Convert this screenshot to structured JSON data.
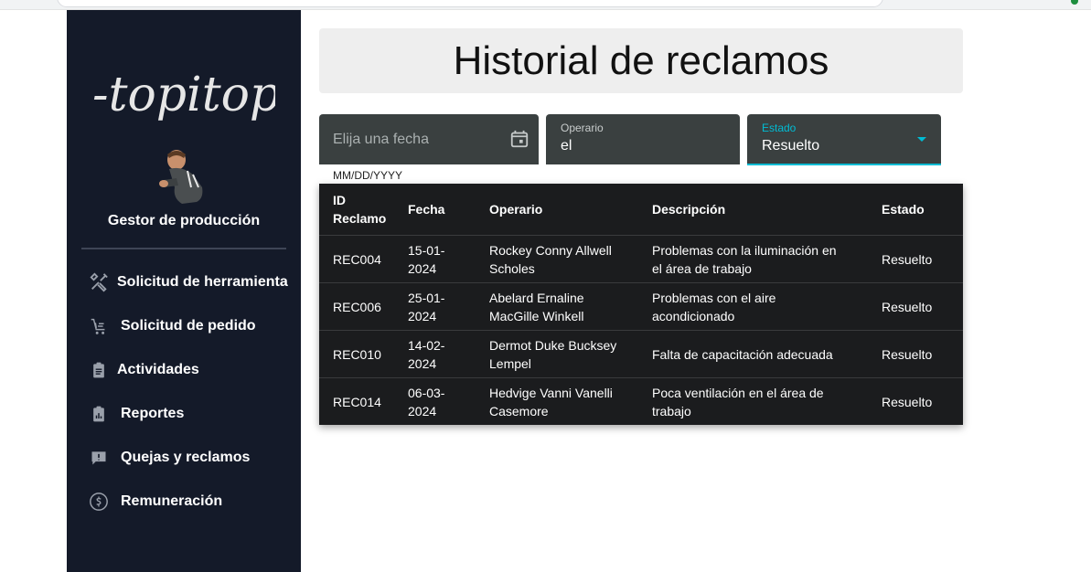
{
  "logo_text": "-topitop",
  "sidebar": {
    "role": "Gestor de producción",
    "items": [
      {
        "label": "Solicitud de herramienta",
        "icon": "tools-icon"
      },
      {
        "label": "Solicitud de pedido",
        "icon": "cart-icon"
      },
      {
        "label": "Actividades",
        "icon": "clipboard-icon"
      },
      {
        "label": "Reportes",
        "icon": "report-icon"
      },
      {
        "label": "Quejas y reclamos",
        "icon": "feedback-icon"
      },
      {
        "label": "Remuneración",
        "icon": "money-icon"
      }
    ]
  },
  "main": {
    "title": "Historial de reclamos",
    "filters": {
      "date_placeholder": "Elija una fecha",
      "date_hint": "MM/DD/YYYY",
      "operario_label": "Operario",
      "operario_value": "el",
      "estado_label": "Estado",
      "estado_value": "Resuelto"
    },
    "table": {
      "headers": {
        "id_line1": "ID",
        "id_line2": "Reclamo",
        "fecha": "Fecha",
        "operario": "Operario",
        "descripcion": "Descripción",
        "estado": "Estado"
      },
      "rows": [
        {
          "id": "REC004",
          "fecha_1": "15-01-",
          "fecha_2": "2024",
          "op_1": "Rockey Conny Allwell",
          "op_2": "Scholes",
          "desc_1": "Problemas con la iluminación en",
          "desc_2": "el área de trabajo",
          "estado": "Resuelto"
        },
        {
          "id": "REC006",
          "fecha_1": "25-01-",
          "fecha_2": "2024",
          "op_1": "Abelard Ernaline",
          "op_2": "MacGille Winkell",
          "desc_1": "Problemas con el aire",
          "desc_2": "acondicionado",
          "estado": "Resuelto"
        },
        {
          "id": "REC010",
          "fecha_1": "14-02-",
          "fecha_2": "2024",
          "op_1": "Dermot Duke Bucksey",
          "op_2": "Lempel",
          "desc_1": "Falta de capacitación adecuada",
          "desc_2": "",
          "estado": "Resuelto"
        },
        {
          "id": "REC014",
          "fecha_1": "06-03-",
          "fecha_2": "2024",
          "op_1": "Hedvige Vanni Vanelli",
          "op_2": "Casemore",
          "desc_1": "Poca ventilación en el área de",
          "desc_2": "trabajo",
          "estado": "Resuelto"
        }
      ]
    }
  },
  "colors": {
    "sidebar_bg": "#141a29",
    "field_bg": "#3a4040",
    "accent": "#00bcd4",
    "table_bg": "#1b1c1e"
  }
}
